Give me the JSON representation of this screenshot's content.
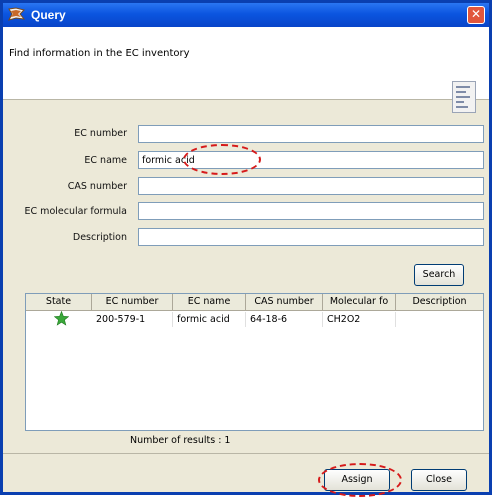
{
  "window": {
    "title": "Query",
    "close_glyph": "✕",
    "app_icon": "flag-logo-icon"
  },
  "header": {
    "text": "Find information in the EC inventory",
    "icon": "document-list-icon"
  },
  "form": {
    "ec_number": {
      "label": "EC number",
      "value": ""
    },
    "ec_name": {
      "label": "EC name",
      "value": "formic acid"
    },
    "cas_number": {
      "label": "CAS number",
      "value": ""
    },
    "ec_formula": {
      "label": "EC molecular formula",
      "value": ""
    },
    "description": {
      "label": "Description",
      "value": ""
    }
  },
  "search_button": "Search",
  "table": {
    "columns": [
      "State",
      "EC number",
      "EC name",
      "CAS number",
      "Molecular fo",
      "Description"
    ],
    "rows": [
      {
        "state_icon": "green-star-icon",
        "ec_number": "200-579-1",
        "ec_name": "formic acid",
        "cas_number": "64-18-6",
        "formula": "CH2O2",
        "description": ""
      }
    ]
  },
  "results_count": "Number of results : 1",
  "buttons": {
    "assign": "Assign",
    "close": "Close"
  },
  "colors": {
    "title_bar": "#0b55e0",
    "highlight_circle": "#d61a1a",
    "star": "#3aa83a"
  }
}
